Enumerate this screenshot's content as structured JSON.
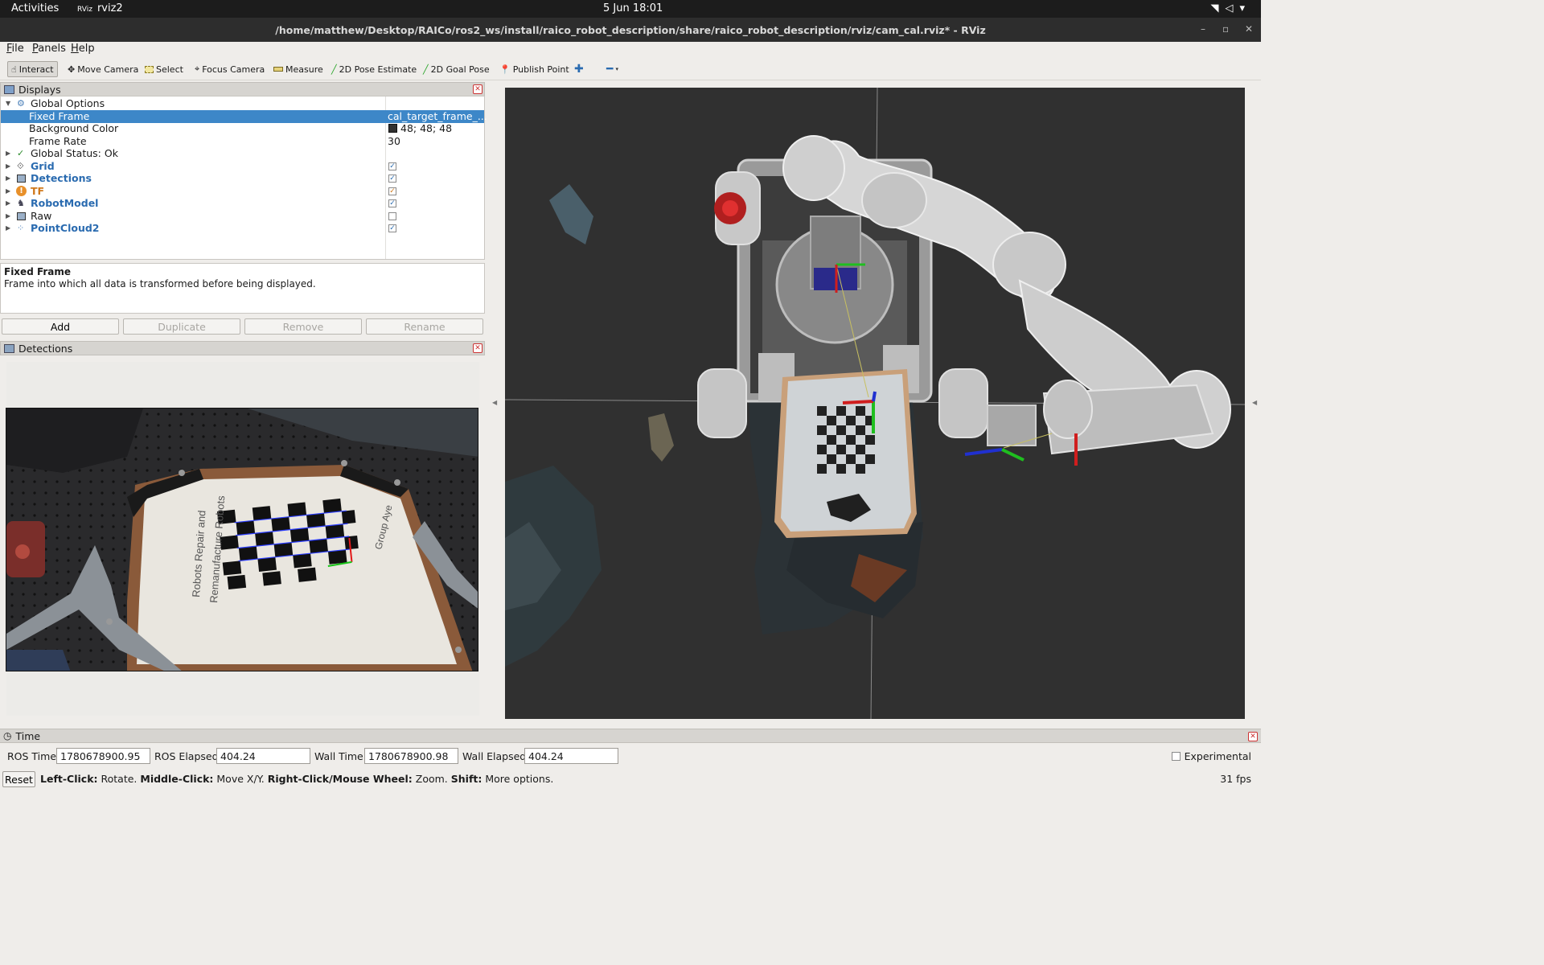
{
  "system_bar": {
    "activities": "Activities",
    "app_name": "rviz2",
    "clock": "5 Jun  18:01"
  },
  "window": {
    "title": "/home/matthew/Desktop/RAICo/ros2_ws/install/raico_robot_description/share/raico_robot_description/rviz/cam_cal.rviz* - RViz"
  },
  "menu": {
    "file": "File",
    "panels": "Panels",
    "help": "Help"
  },
  "toolbar": {
    "interact": "Interact",
    "move_camera": "Move Camera",
    "select": "Select",
    "focus_camera": "Focus Camera",
    "measure": "Measure",
    "pose_estimate": "2D Pose Estimate",
    "goal_pose": "2D Goal Pose",
    "publish_point": "Publish Point"
  },
  "displays": {
    "title": "Displays",
    "rows": [
      {
        "label": "Global Options",
        "icon": "gear-icon",
        "value": ""
      },
      {
        "label": "Fixed Frame",
        "value": "cal_target_frame_..."
      },
      {
        "label": "Background Color",
        "value": "48; 48; 48",
        "color": "#303030"
      },
      {
        "label": "Frame Rate",
        "value": "30"
      },
      {
        "label": "Global Status: Ok",
        "icon": "check-icon"
      },
      {
        "label": "Grid",
        "icon": "grid-icon",
        "checked": true
      },
      {
        "label": "Detections",
        "icon": "image-icon",
        "checked": true
      },
      {
        "label": "TF",
        "icon": "warning-icon",
        "checked": true
      },
      {
        "label": "RobotModel",
        "icon": "robot-icon",
        "checked": true
      },
      {
        "label": "Raw",
        "icon": "image-icon",
        "checked": false
      },
      {
        "label": "PointCloud2",
        "icon": "pointcloud-icon",
        "checked": true
      }
    ],
    "description_title": "Fixed Frame",
    "description_text": "Frame into which all data is transformed before being displayed.",
    "buttons": {
      "add": "Add",
      "duplicate": "Duplicate",
      "remove": "Remove",
      "rename": "Rename"
    }
  },
  "detections_panel": {
    "title": "Detections",
    "board_text_1": "Robots Repair and",
    "board_text_2": "Remanufacture Robots",
    "board_text_3": "Group Aye"
  },
  "time_panel": {
    "title": "Time",
    "ros_time_label": "ROS Time:",
    "ros_time": "1780678900.95",
    "ros_elapsed_label": "ROS Elapsed:",
    "ros_elapsed": "404.24",
    "wall_time_label": "Wall Time:",
    "wall_time": "1780678900.98",
    "wall_elapsed_label": "Wall Elapsed:",
    "wall_elapsed": "404.24",
    "experimental": "Experimental"
  },
  "status": {
    "reset": "Reset",
    "left_click": "Left-Click:",
    "rotate": " Rotate. ",
    "middle_click": "Middle-Click:",
    "move": " Move X/Y. ",
    "right_click": "Right-Click/Mouse Wheel:",
    "zoom": " Zoom. ",
    "shift": "Shift:",
    "more": " More options.",
    "fps": "31 fps"
  }
}
